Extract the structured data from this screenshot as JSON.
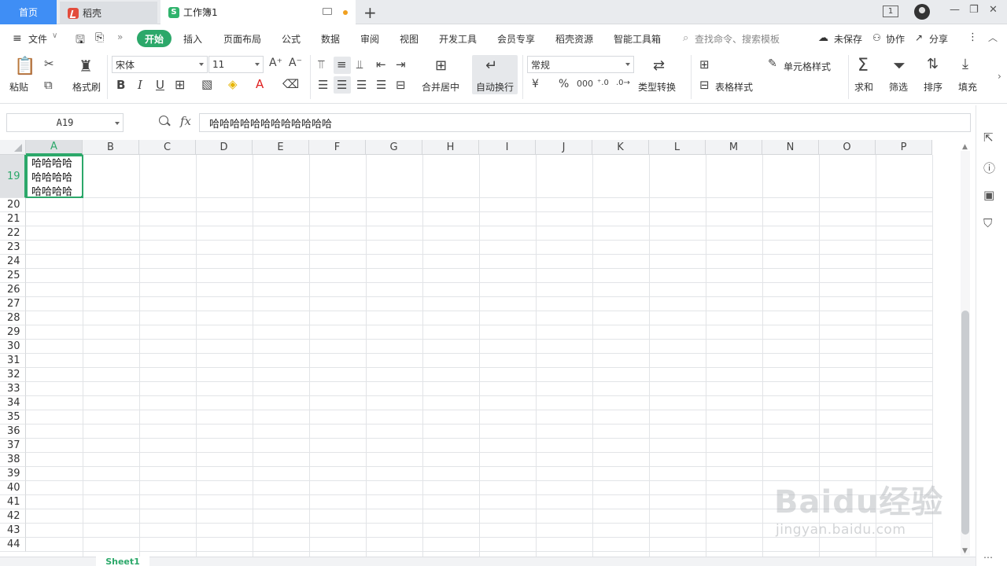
{
  "tabs": {
    "home": "首页",
    "daoke": "稻壳",
    "workbook": "工作簿1"
  },
  "window": {
    "badge": "1"
  },
  "menu": {
    "file": "文件",
    "start": "开始",
    "items": [
      "插入",
      "页面布局",
      "公式",
      "数据",
      "审阅",
      "视图",
      "开发工具",
      "会员专享",
      "稻壳资源",
      "智能工具箱"
    ],
    "search_placeholder": "查找命令、搜索模板",
    "unsaved": "未保存",
    "collab": "协作",
    "share": "分享"
  },
  "ribbon": {
    "paste": "粘贴",
    "format_painter": "格式刷",
    "font_name": "宋体",
    "font_size": "11",
    "merge_center": "合并居中",
    "wrap_text": "自动换行",
    "number_format": "常规",
    "type_convert": "类型转换",
    "cond_format": "单元格样式",
    "table_style": "表格样式",
    "sum": "求和",
    "filter": "筛选",
    "sort": "排序",
    "fill": "填充"
  },
  "formula": {
    "cell_ref": "A19",
    "fx": "fx",
    "content": "哈哈哈哈哈哈哈哈哈哈哈哈"
  },
  "grid": {
    "columns": [
      "A",
      "B",
      "C",
      "D",
      "E",
      "F",
      "G",
      "H",
      "I",
      "J",
      "K",
      "L",
      "M",
      "N",
      "O",
      "P"
    ],
    "rows": [
      "19",
      "20",
      "21",
      "22",
      "23",
      "24",
      "25",
      "26",
      "27",
      "28",
      "29",
      "30",
      "31",
      "32",
      "33",
      "34",
      "35",
      "36",
      "37",
      "38",
      "39",
      "40",
      "41",
      "42",
      "43",
      "44"
    ],
    "active_cell_text": "哈哈哈哈哈哈哈哈哈哈哈哈"
  },
  "sheet": {
    "name": "Sheet1"
  },
  "watermark": {
    "brand": "Baidu经验",
    "url": "jingyan.baidu.com"
  },
  "colors": {
    "accent": "#2ca86a",
    "home_tab": "#3f8ef5"
  }
}
